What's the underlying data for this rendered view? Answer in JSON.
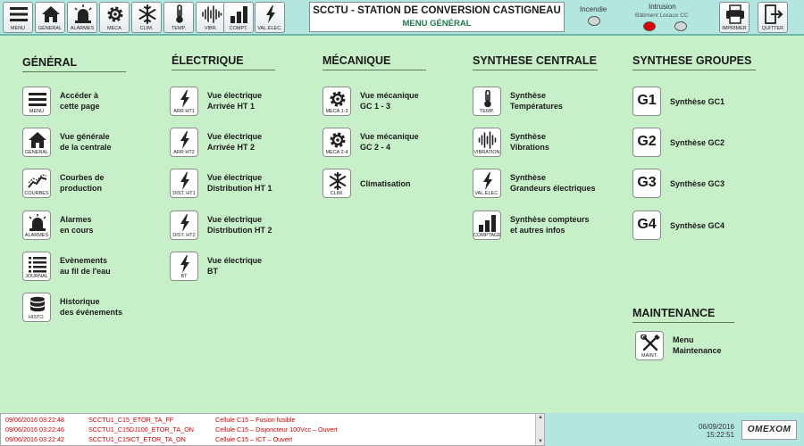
{
  "toolbar": {
    "buttons": [
      {
        "label": "MENU",
        "icon": "menu-icon"
      },
      {
        "label": "GÉNÉRAL",
        "icon": "home-icon"
      },
      {
        "label": "ALARMES",
        "icon": "siren-icon"
      },
      {
        "label": "MÉCA",
        "icon": "gear-icon"
      },
      {
        "label": "CLIM.",
        "icon": "snowflake-icon"
      },
      {
        "label": "TEMP.",
        "icon": "thermometer-icon"
      },
      {
        "label": "VIBR.",
        "icon": "vibration-icon"
      },
      {
        "label": "COMPT.",
        "icon": "bar-chart-icon"
      },
      {
        "label": "VAL.ELEC.",
        "icon": "lightning-icon"
      }
    ],
    "title": "SCCTU - STATION DE CONVERSION CASTIGNEAU",
    "subtitle": "MENU GÉNÉRAL",
    "incendie_label": "Incendie",
    "intrusion_label": "Intrusion",
    "intrusion_sub": "Bâtiment Locaux CC",
    "print_label": "IMPRIMER",
    "quit_label": "QUITTER",
    "colors": {
      "lamp_off": "#cfd6d6",
      "lamp_alarm": "#dd0000"
    }
  },
  "sections": {
    "general": {
      "title": "GÉNÉRAL",
      "items": [
        {
          "icon_label": "MENU",
          "icon": "menu-icon",
          "line1": "Accéder à",
          "line2": "cette page"
        },
        {
          "icon_label": "GÉNÉRAL",
          "icon": "home-icon",
          "line1": "Vue générale",
          "line2": "de la centrale"
        },
        {
          "icon_label": "COURBES",
          "icon": "trend-icon",
          "line1": "Courbes de",
          "line2": "production"
        },
        {
          "icon_label": "ALARMES",
          "icon": "siren-icon",
          "line1": "Alarmes",
          "line2": "en cours"
        },
        {
          "icon_label": "JOURNAL",
          "icon": "list-icon",
          "line1": "Evènements",
          "line2": "au fil de l'eau"
        },
        {
          "icon_label": "HISTO.",
          "icon": "database-icon",
          "line1": "Historique",
          "line2": "des événements"
        }
      ]
    },
    "electrique": {
      "title": "ÉLECTRIQUE",
      "items": [
        {
          "icon_label": "ARR HT1",
          "icon": "lightning-icon",
          "line1": "Vue électrique",
          "line2": "Arrivée HT 1"
        },
        {
          "icon_label": "ARR HT2",
          "icon": "lightning-icon",
          "line1": "Vue électrique",
          "line2": "Arrivée HT 2"
        },
        {
          "icon_label": "DIST. HT1",
          "icon": "lightning-icon",
          "line1": "Vue électrique",
          "line2": "Distribution HT 1"
        },
        {
          "icon_label": "DIST. HT2",
          "icon": "lightning-icon",
          "line1": "Vue électrique",
          "line2": "Distribution HT 2"
        },
        {
          "icon_label": "BT",
          "icon": "lightning-icon",
          "line1": "Vue électrique",
          "line2": "BT"
        }
      ]
    },
    "mecanique": {
      "title": "MÉCANIQUE",
      "items": [
        {
          "icon_label": "MÉCA 1-3",
          "icon": "gear-icon",
          "line1": "Vue mécanique",
          "line2": "GC 1 - 3"
        },
        {
          "icon_label": "MÉCA 2-4",
          "icon": "gear-icon",
          "line1": "Vue mécanique",
          "line2": "GC 2 - 4"
        },
        {
          "icon_label": "CLIM.",
          "icon": "snowflake-icon",
          "line1": "Climatisation",
          "line2": ""
        }
      ]
    },
    "synthese_centrale": {
      "title": "SYNTHESE CENTRALE",
      "items": [
        {
          "icon_label": "TEMP.",
          "icon": "thermometer-icon",
          "line1": "Synthèse",
          "line2": "Températures"
        },
        {
          "icon_label": "VIBRATION",
          "icon": "vibration-icon",
          "line1": "Synthèse",
          "line2": "Vibrations"
        },
        {
          "icon_label": "VAL.ELEC.",
          "icon": "lightning-icon",
          "line1": "Synthèse",
          "line2": "Grandeurs électriques"
        },
        {
          "icon_label": "COMPTAGE",
          "icon": "bar-chart-icon",
          "line1": "Synthèse compteurs",
          "line2": "et autres infos"
        }
      ]
    },
    "synthese_groupes": {
      "title": "SYNTHESE GROUPES",
      "items": [
        {
          "icon_text": "G1",
          "line1": "Synthèse GC1"
        },
        {
          "icon_text": "G2",
          "line1": "Synthèse GC2"
        },
        {
          "icon_text": "G3",
          "line1": "Synthèse GC3"
        },
        {
          "icon_text": "G4",
          "line1": "Synthèse GC4"
        }
      ]
    },
    "maintenance": {
      "title": "MAINTENANCE",
      "items": [
        {
          "icon_label": "MAINT.",
          "icon": "tools-icon",
          "line1": "Menu",
          "line2": "Maintenance"
        }
      ]
    }
  },
  "event_log": {
    "rows": [
      {
        "time": "09/06/2016 03:22:48",
        "tag": "SCCTU1_C15_ETOR_TA_FF",
        "desc": "Cellule C15 – Fusion fusible"
      },
      {
        "time": "09/06/2016 03:22:46",
        "tag": "SCCTU1_C15DJ100_ETOR_TA_ON",
        "desc": "Cellule C15 – Disjoncteur 100Vcc – Ouvert"
      },
      {
        "time": "09/06/2016 03:22:42",
        "tag": "SCCTU1_C15ICT_ETOR_TA_ON",
        "desc": "Cellule C15 – ICT – Ouvert"
      }
    ],
    "color": "#cc0000"
  },
  "status": {
    "date": "06/09/2016",
    "time": "15:22:51",
    "logo": "OMEXOM"
  }
}
